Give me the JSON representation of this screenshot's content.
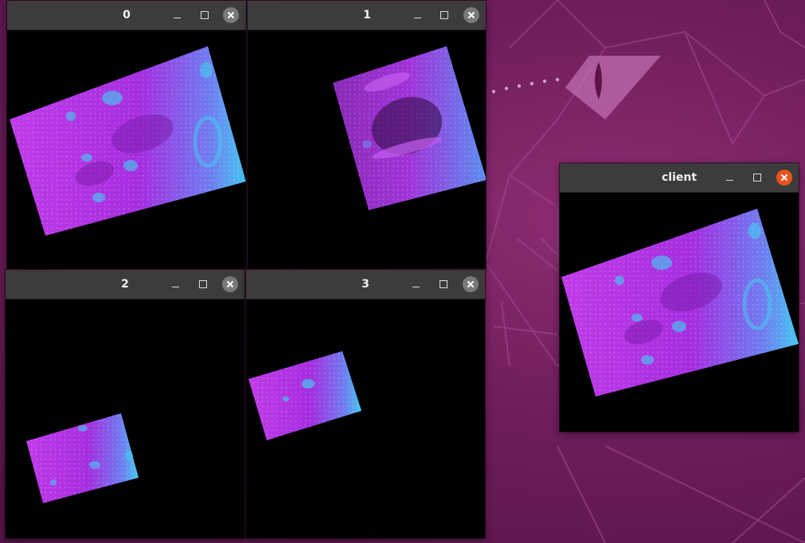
{
  "desktop": {
    "windows": [
      {
        "title": "0"
      },
      {
        "title": "1"
      },
      {
        "title": "2"
      },
      {
        "title": "3"
      },
      {
        "title": "client"
      }
    ]
  },
  "colors": {
    "titlebar": "#3d3b3b",
    "close_active": "#e95420",
    "close_inactive": "#7a7878",
    "image_magenta": "#c03ce8",
    "image_cyan": "#45c8f0",
    "wallpaper": "#6e1d5a"
  },
  "icons": [
    "minimize-icon",
    "maximize-icon",
    "close-icon"
  ]
}
